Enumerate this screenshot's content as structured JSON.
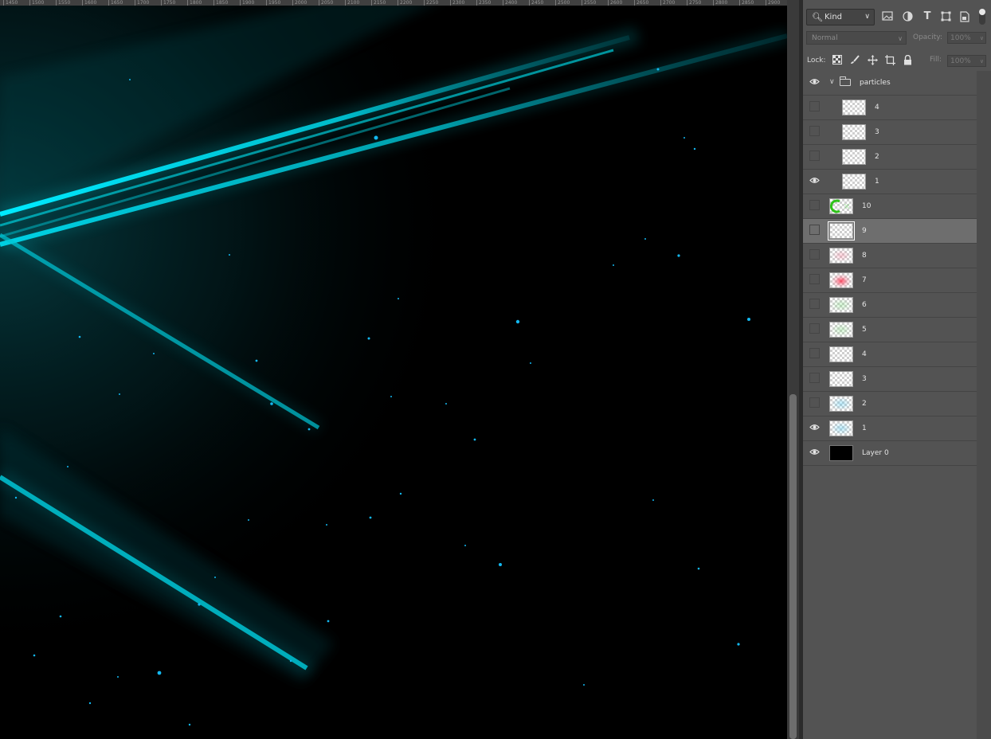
{
  "ruler": {
    "ticks": [
      "1450",
      "1500",
      "1550",
      "1600",
      "1650",
      "1700",
      "1750",
      "1800",
      "1850",
      "1900",
      "1950",
      "2000",
      "2050",
      "2100",
      "2150",
      "2200",
      "2250",
      "2300",
      "2350",
      "2400",
      "2450",
      "2500",
      "2550",
      "2600",
      "2650",
      "2700",
      "2750",
      "2800",
      "2850",
      "2900"
    ]
  },
  "layers_panel": {
    "filter": {
      "kind_label": "Kind"
    },
    "blend_mode": "Normal",
    "opacity_label": "Opacity:",
    "opacity_value": "100%",
    "lock_label": "Lock:",
    "fill_label": "Fill:",
    "fill_value": "100%",
    "layers": [
      {
        "name": "particles",
        "visible": true,
        "type": "group",
        "indent": false
      },
      {
        "name": "4",
        "visible": false,
        "type": "layer",
        "indent": true,
        "thumb": "checker"
      },
      {
        "name": "3",
        "visible": false,
        "type": "layer",
        "indent": true,
        "thumb": "checker"
      },
      {
        "name": "2",
        "visible": false,
        "type": "layer",
        "indent": true,
        "thumb": "checker"
      },
      {
        "name": "1",
        "visible": true,
        "type": "layer",
        "indent": true,
        "thumb": "checker"
      },
      {
        "name": "10",
        "visible": false,
        "type": "layer",
        "indent": false,
        "thumb": "green-arc"
      },
      {
        "name": "9",
        "visible": false,
        "type": "layer",
        "indent": false,
        "thumb": "checker",
        "selected": true
      },
      {
        "name": "8",
        "visible": false,
        "type": "layer",
        "indent": false,
        "thumb": "pink-faint"
      },
      {
        "name": "7",
        "visible": false,
        "type": "layer",
        "indent": false,
        "thumb": "red"
      },
      {
        "name": "6",
        "visible": false,
        "type": "layer",
        "indent": false,
        "thumb": "green-faint"
      },
      {
        "name": "5",
        "visible": false,
        "type": "layer",
        "indent": false,
        "thumb": "green-faint"
      },
      {
        "name": "4",
        "visible": false,
        "type": "layer",
        "indent": false,
        "thumb": "checker"
      },
      {
        "name": "3",
        "visible": false,
        "type": "layer",
        "indent": false,
        "thumb": "checker"
      },
      {
        "name": "2",
        "visible": false,
        "type": "layer",
        "indent": false,
        "thumb": "blue-faint"
      },
      {
        "name": "1",
        "visible": true,
        "type": "layer",
        "indent": false,
        "thumb": "blue-faint"
      },
      {
        "name": "Layer 0",
        "visible": true,
        "type": "layer",
        "indent": false,
        "thumb": "black"
      }
    ]
  },
  "colors": {
    "accent_cyan": "#00e5f2",
    "panel_bg": "#535353",
    "selected_row": "#6e6e6e"
  }
}
